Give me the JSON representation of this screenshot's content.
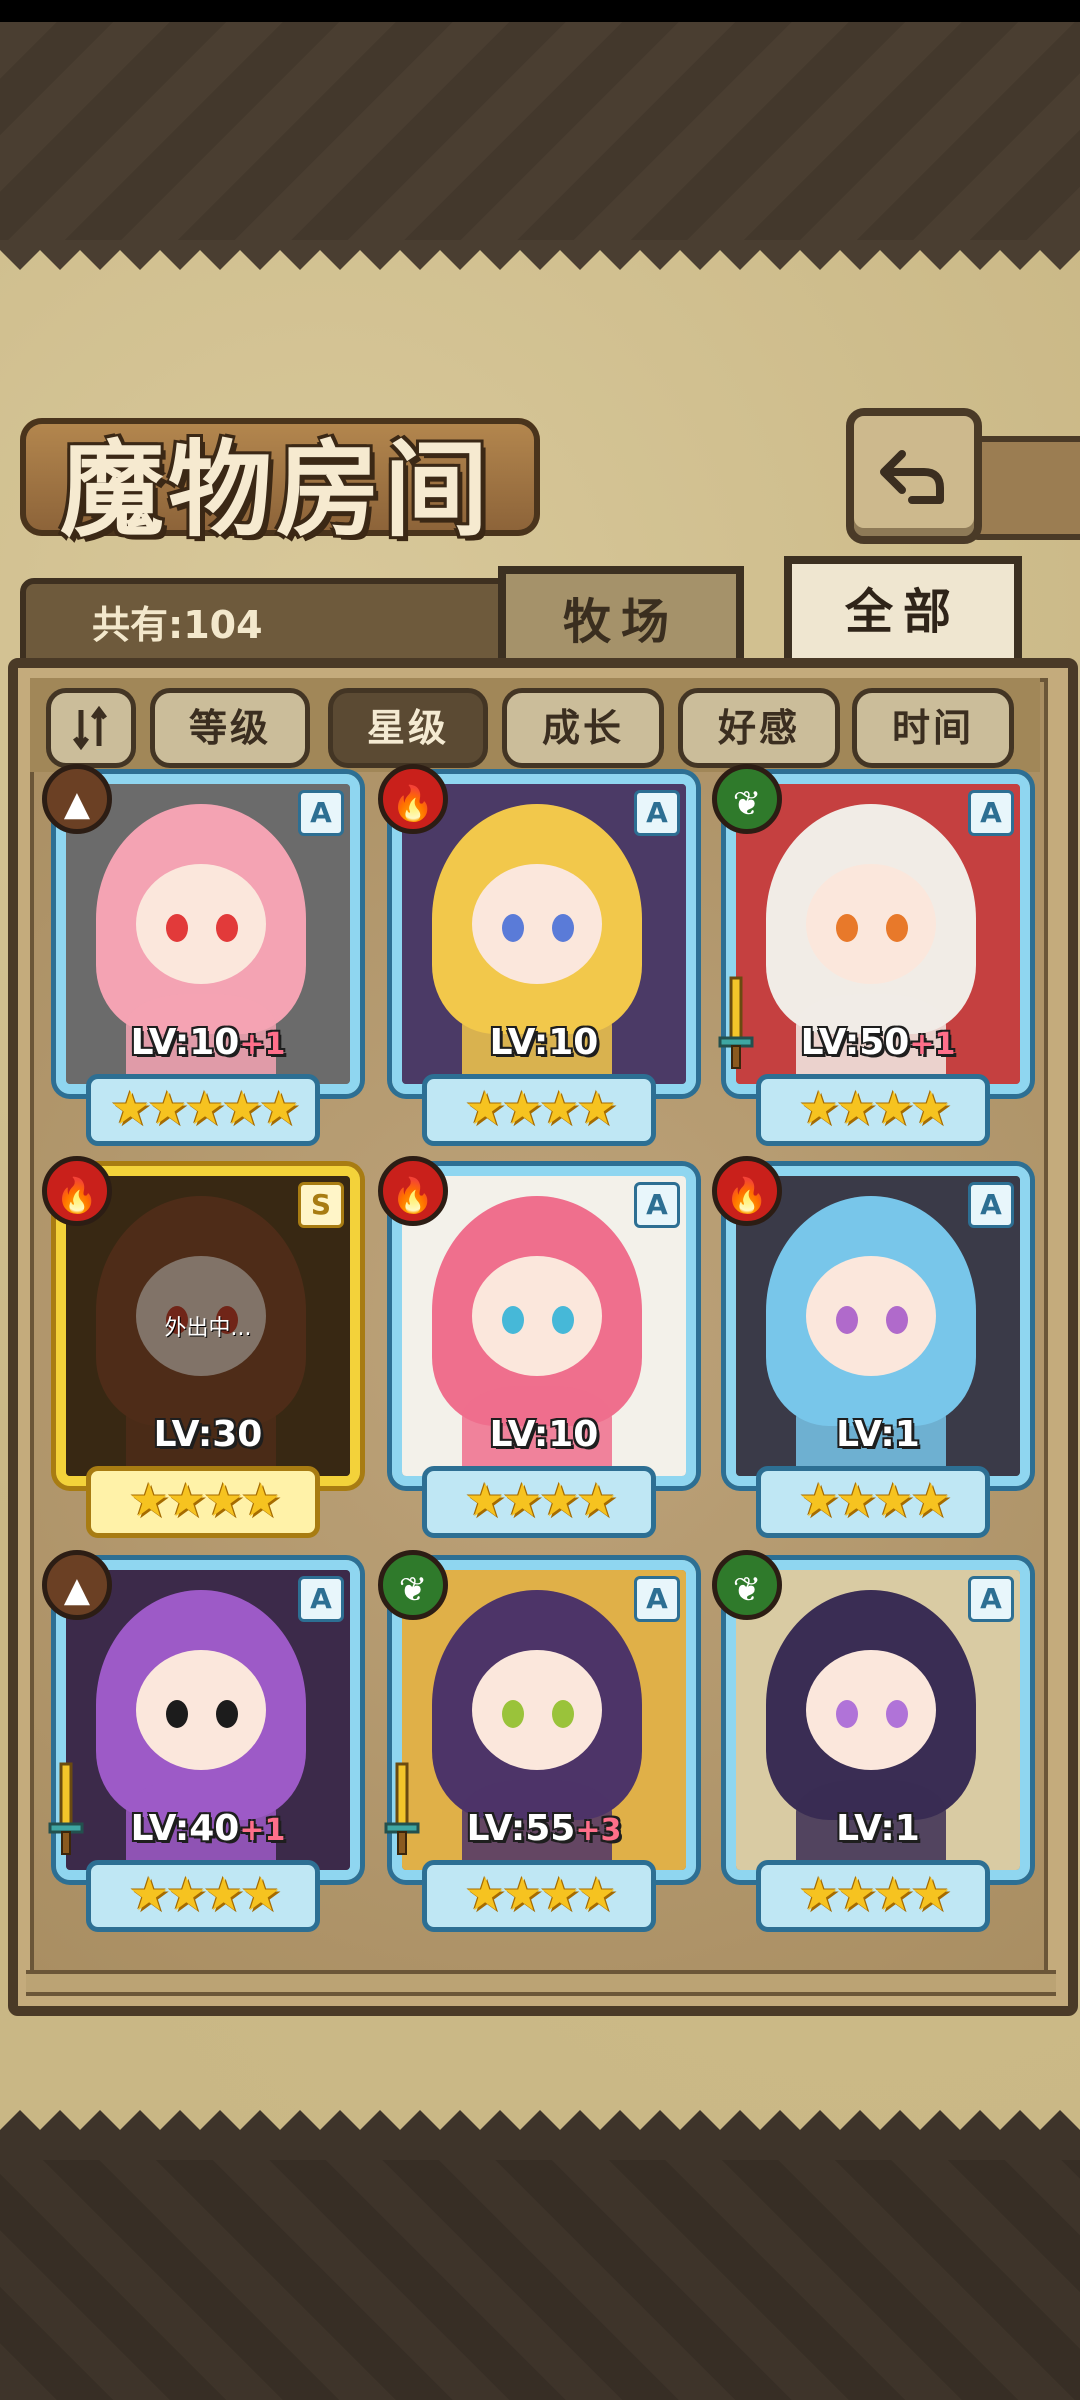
{
  "header": {
    "title": "魔物房间",
    "back_icon": "return-arrow-icon",
    "count_label": "共有:104"
  },
  "tabs": [
    {
      "label": "牧场",
      "active": false
    },
    {
      "label": "全部",
      "active": true
    }
  ],
  "sort": {
    "toggle_icon": "sort-order-icon",
    "buttons": [
      {
        "label": "等级",
        "active": false
      },
      {
        "label": "星级",
        "active": true
      },
      {
        "label": "成长",
        "active": false
      },
      {
        "label": "好感",
        "active": false
      },
      {
        "label": "时间",
        "active": false
      }
    ]
  },
  "monsters": [
    {
      "level": "LV:10",
      "plus": "+1",
      "grade": "A",
      "element": "earth",
      "stars": "★★★★★",
      "weapon": false,
      "away": "",
      "hair": "#f4a3b3",
      "eye": "#e23a3a",
      "bg": "#6b6b6b"
    },
    {
      "level": "LV:10",
      "plus": "",
      "grade": "A",
      "element": "fire",
      "stars": "★★★★",
      "weapon": false,
      "away": "",
      "hair": "#f2c84b",
      "eye": "#5a7bd8",
      "bg": "#4b3a66"
    },
    {
      "level": "LV:50",
      "plus": "+1",
      "grade": "A",
      "element": "wood",
      "stars": "★★★★",
      "weapon": true,
      "away": "",
      "hair": "#f1ece6",
      "eye": "#e8792a",
      "bg": "#c54040"
    },
    {
      "level": "LV:30",
      "plus": "",
      "grade": "S",
      "element": "fire",
      "stars": "★★★★",
      "weapon": false,
      "away": "外出中...",
      "hair": "#8a4a2a",
      "eye": "#d43a2a",
      "bg": "#5a4020"
    },
    {
      "level": "LV:10",
      "plus": "",
      "grade": "A",
      "element": "fire",
      "stars": "★★★★",
      "weapon": false,
      "away": "",
      "hair": "#ef6f8d",
      "eye": "#46b8d8",
      "bg": "#f3f1ea"
    },
    {
      "level": "LV:1",
      "plus": "",
      "grade": "A",
      "element": "fire",
      "stars": "★★★★",
      "weapon": false,
      "away": "",
      "hair": "#78c6ea",
      "eye": "#b06acb",
      "bg": "#3a3a48"
    },
    {
      "level": "LV:40",
      "plus": "+1",
      "grade": "A",
      "element": "earth",
      "stars": "★★★★",
      "weapon": true,
      "away": "",
      "hair": "#9d5ac7",
      "eye": "#1c1c1c",
      "bg": "#3c2a4a"
    },
    {
      "level": "LV:55",
      "plus": "+3",
      "grade": "A",
      "element": "wood",
      "stars": "★★★★",
      "weapon": true,
      "away": "",
      "hair": "#4d3468",
      "eye": "#9ac33a",
      "bg": "#e0b048"
    },
    {
      "level": "LV:1",
      "plus": "",
      "grade": "A",
      "element": "wood",
      "stars": "★★★★",
      "weapon": false,
      "away": "",
      "hair": "#3a2d54",
      "eye": "#b073d8",
      "bg": "#d9cba3"
    }
  ],
  "colors": {
    "fire": "#c9201b",
    "earth": "#6b4024",
    "wood": "#2f7a2b"
  }
}
